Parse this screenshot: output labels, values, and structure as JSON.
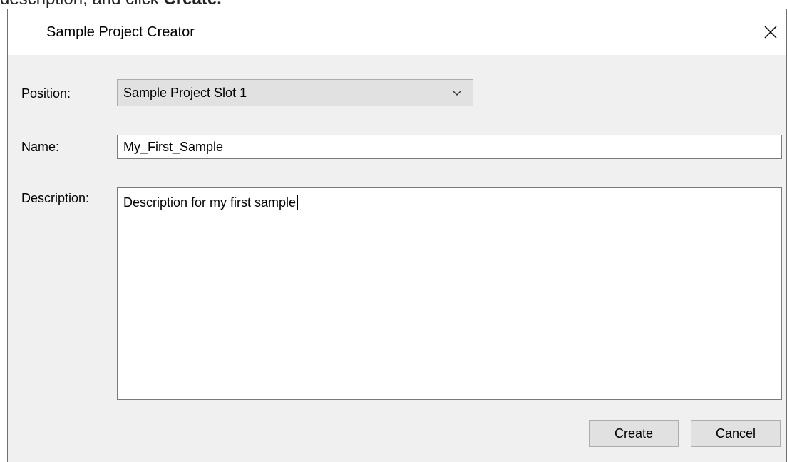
{
  "doc_snippet": {
    "text": "description, and click ",
    "bold": "Create."
  },
  "dialog": {
    "title": "Sample Project Creator",
    "close_icon": "close-icon"
  },
  "form": {
    "position": {
      "label": "Position:",
      "selected": "Sample Project Slot 1",
      "icon": "chevron-down-icon"
    },
    "name": {
      "label": "Name:",
      "value": "My_First_Sample"
    },
    "description": {
      "label": "Description:",
      "value": "Description for my first sample"
    }
  },
  "buttons": {
    "create": "Create",
    "cancel": "Cancel"
  }
}
